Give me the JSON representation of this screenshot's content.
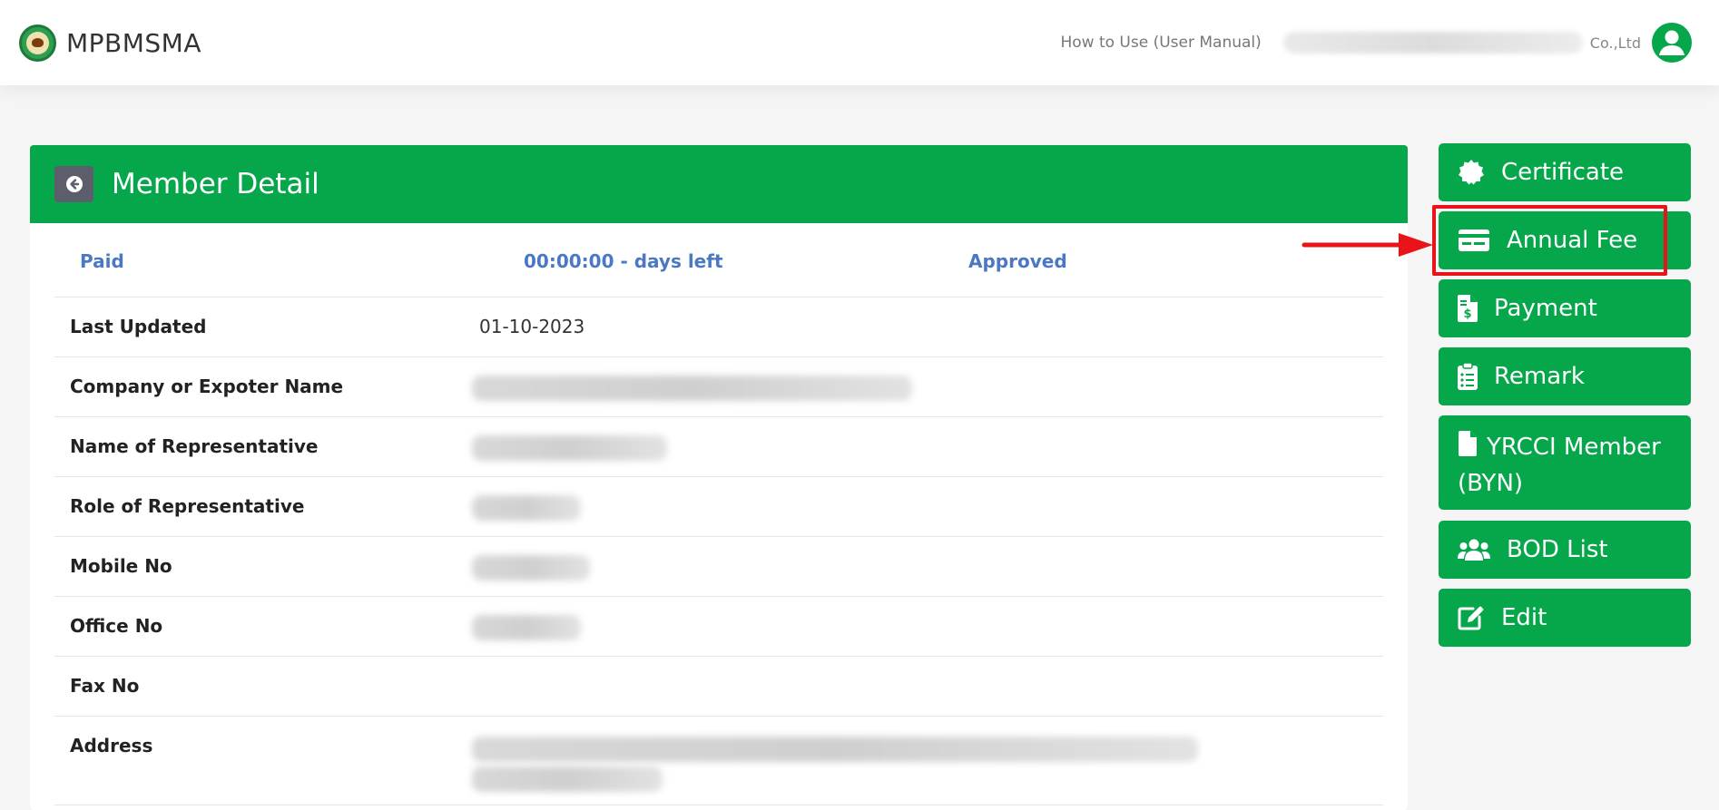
{
  "header": {
    "brand_name": "MPBMSMA",
    "manual_link": "How to Use (User Manual)",
    "company_suffix": "Co.,Ltd",
    "logo_icon": "association-seal-icon",
    "avatar_icon": "user-avatar-icon"
  },
  "card": {
    "title": "Member Detail",
    "back_icon": "arrow-left-circle-icon",
    "status": {
      "payment": "Paid",
      "countdown": "00:00:00 - days left",
      "approval": "Approved"
    },
    "fields": [
      {
        "label": "Last Updated",
        "value": "01-10-2023"
      },
      {
        "label": "Company or Expoter Name",
        "value": ""
      },
      {
        "label": "Name of Representative",
        "value": ""
      },
      {
        "label": "Role of Representative",
        "value": ""
      },
      {
        "label": "Mobile No",
        "value": ""
      },
      {
        "label": "Office No",
        "value": ""
      },
      {
        "label": "Fax No",
        "value": ""
      },
      {
        "label": "Address",
        "value": ""
      }
    ]
  },
  "side_menu": [
    {
      "label": "Certificate",
      "icon": "certificate-badge-icon"
    },
    {
      "label": "Annual Fee",
      "icon": "credit-card-icon"
    },
    {
      "label": "Payment",
      "icon": "invoice-dollar-icon"
    },
    {
      "label": "Remark",
      "icon": "clipboard-list-icon"
    },
    {
      "label": "YRCCI Member",
      "label_line2": "(BYN)",
      "icon": "file-icon"
    },
    {
      "label": "BOD List",
      "icon": "users-icon"
    },
    {
      "label": "Edit",
      "icon": "edit-icon"
    }
  ],
  "colors": {
    "primary_green": "#06a64b",
    "status_blue": "#4a78c2",
    "highlight_red": "#e8141a"
  }
}
